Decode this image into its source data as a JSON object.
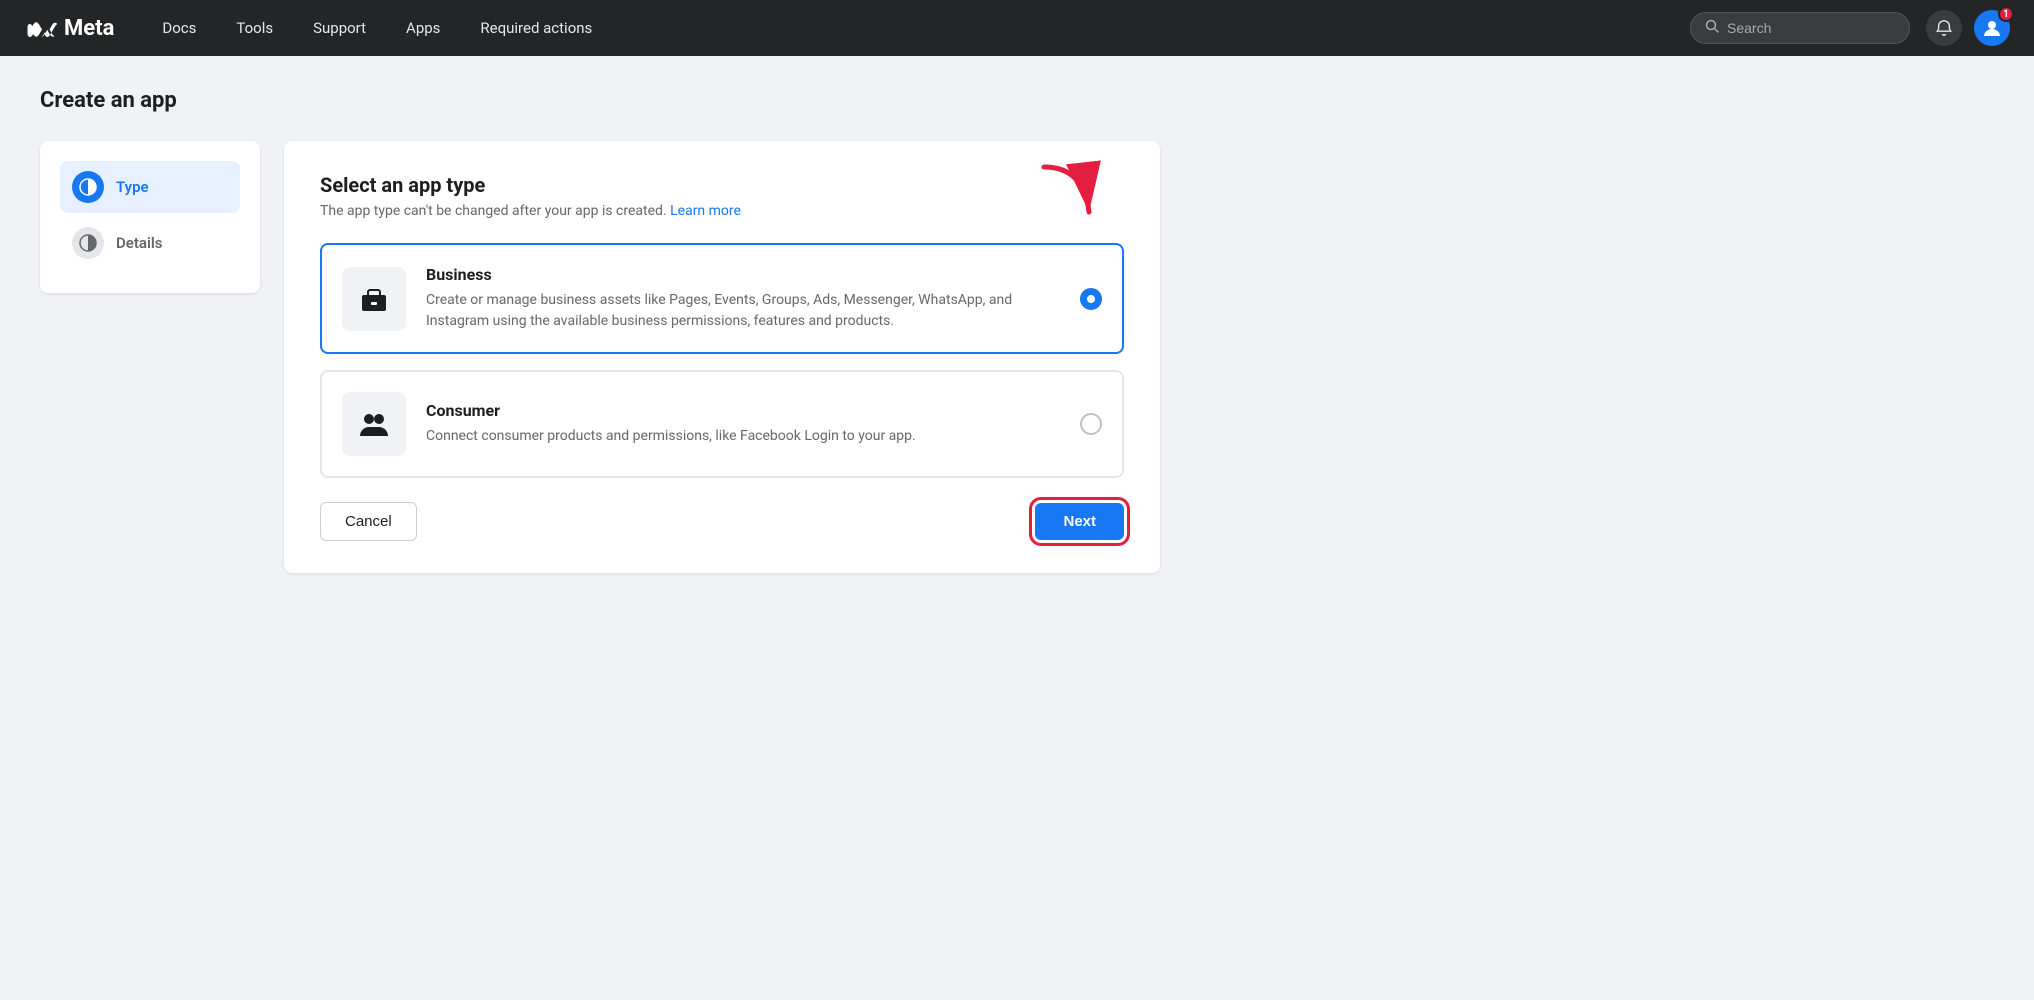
{
  "navbar": {
    "logo_text": "Meta",
    "nav_items": [
      {
        "label": "Docs",
        "id": "docs"
      },
      {
        "label": "Tools",
        "id": "tools"
      },
      {
        "label": "Support",
        "id": "support"
      },
      {
        "label": "Apps",
        "id": "apps"
      },
      {
        "label": "Required actions",
        "id": "required-actions"
      }
    ],
    "search_placeholder": "Search",
    "notification_count": "1"
  },
  "page": {
    "title": "Create an app"
  },
  "steps": [
    {
      "label": "Type",
      "state": "active",
      "icon": "half-circle"
    },
    {
      "label": "Details",
      "state": "inactive",
      "icon": "half-circle"
    }
  ],
  "card": {
    "title": "Select an app type",
    "subtitle": "The app type can't be changed after your app is created.",
    "learn_more_label": "Learn more",
    "app_types": [
      {
        "id": "business",
        "name": "Business",
        "description": "Create or manage business assets like Pages, Events, Groups, Ads, Messenger, WhatsApp, and Instagram using the available business permissions, features and products.",
        "selected": true,
        "icon": "briefcase"
      },
      {
        "id": "consumer",
        "name": "Consumer",
        "description": "Connect consumer products and permissions, like Facebook Login to your app.",
        "selected": false,
        "icon": "people"
      }
    ],
    "cancel_label": "Cancel",
    "next_label": "Next"
  }
}
